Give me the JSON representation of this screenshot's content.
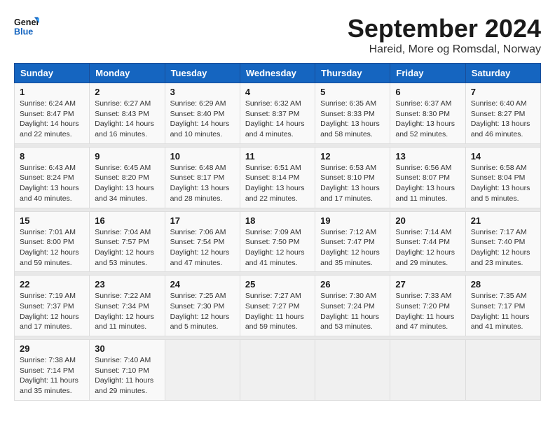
{
  "header": {
    "logo_line1": "General",
    "logo_line2": "Blue",
    "month": "September 2024",
    "location": "Hareid, More og Romsdal, Norway"
  },
  "days_of_week": [
    "Sunday",
    "Monday",
    "Tuesday",
    "Wednesday",
    "Thursday",
    "Friday",
    "Saturday"
  ],
  "weeks": [
    [
      {
        "day": "1",
        "rise": "6:24 AM",
        "set": "8:47 PM",
        "daylight": "14 hours and 22 minutes."
      },
      {
        "day": "2",
        "rise": "6:27 AM",
        "set": "8:43 PM",
        "daylight": "14 hours and 16 minutes."
      },
      {
        "day": "3",
        "rise": "6:29 AM",
        "set": "8:40 PM",
        "daylight": "14 hours and 10 minutes."
      },
      {
        "day": "4",
        "rise": "6:32 AM",
        "set": "8:37 PM",
        "daylight": "14 hours and 4 minutes."
      },
      {
        "day": "5",
        "rise": "6:35 AM",
        "set": "8:33 PM",
        "daylight": "13 hours and 58 minutes."
      },
      {
        "day": "6",
        "rise": "6:37 AM",
        "set": "8:30 PM",
        "daylight": "13 hours and 52 minutes."
      },
      {
        "day": "7",
        "rise": "6:40 AM",
        "set": "8:27 PM",
        "daylight": "13 hours and 46 minutes."
      }
    ],
    [
      {
        "day": "8",
        "rise": "6:43 AM",
        "set": "8:24 PM",
        "daylight": "13 hours and 40 minutes."
      },
      {
        "day": "9",
        "rise": "6:45 AM",
        "set": "8:20 PM",
        "daylight": "13 hours and 34 minutes."
      },
      {
        "day": "10",
        "rise": "6:48 AM",
        "set": "8:17 PM",
        "daylight": "13 hours and 28 minutes."
      },
      {
        "day": "11",
        "rise": "6:51 AM",
        "set": "8:14 PM",
        "daylight": "13 hours and 22 minutes."
      },
      {
        "day": "12",
        "rise": "6:53 AM",
        "set": "8:10 PM",
        "daylight": "13 hours and 17 minutes."
      },
      {
        "day": "13",
        "rise": "6:56 AM",
        "set": "8:07 PM",
        "daylight": "13 hours and 11 minutes."
      },
      {
        "day": "14",
        "rise": "6:58 AM",
        "set": "8:04 PM",
        "daylight": "13 hours and 5 minutes."
      }
    ],
    [
      {
        "day": "15",
        "rise": "7:01 AM",
        "set": "8:00 PM",
        "daylight": "12 hours and 59 minutes."
      },
      {
        "day": "16",
        "rise": "7:04 AM",
        "set": "7:57 PM",
        "daylight": "12 hours and 53 minutes."
      },
      {
        "day": "17",
        "rise": "7:06 AM",
        "set": "7:54 PM",
        "daylight": "12 hours and 47 minutes."
      },
      {
        "day": "18",
        "rise": "7:09 AM",
        "set": "7:50 PM",
        "daylight": "12 hours and 41 minutes."
      },
      {
        "day": "19",
        "rise": "7:12 AM",
        "set": "7:47 PM",
        "daylight": "12 hours and 35 minutes."
      },
      {
        "day": "20",
        "rise": "7:14 AM",
        "set": "7:44 PM",
        "daylight": "12 hours and 29 minutes."
      },
      {
        "day": "21",
        "rise": "7:17 AM",
        "set": "7:40 PM",
        "daylight": "12 hours and 23 minutes."
      }
    ],
    [
      {
        "day": "22",
        "rise": "7:19 AM",
        "set": "7:37 PM",
        "daylight": "12 hours and 17 minutes."
      },
      {
        "day": "23",
        "rise": "7:22 AM",
        "set": "7:34 PM",
        "daylight": "12 hours and 11 minutes."
      },
      {
        "day": "24",
        "rise": "7:25 AM",
        "set": "7:30 PM",
        "daylight": "12 hours and 5 minutes."
      },
      {
        "day": "25",
        "rise": "7:27 AM",
        "set": "7:27 PM",
        "daylight": "11 hours and 59 minutes."
      },
      {
        "day": "26",
        "rise": "7:30 AM",
        "set": "7:24 PM",
        "daylight": "11 hours and 53 minutes."
      },
      {
        "day": "27",
        "rise": "7:33 AM",
        "set": "7:20 PM",
        "daylight": "11 hours and 47 minutes."
      },
      {
        "day": "28",
        "rise": "7:35 AM",
        "set": "7:17 PM",
        "daylight": "11 hours and 41 minutes."
      }
    ],
    [
      {
        "day": "29",
        "rise": "7:38 AM",
        "set": "7:14 PM",
        "daylight": "11 hours and 35 minutes."
      },
      {
        "day": "30",
        "rise": "7:40 AM",
        "set": "7:10 PM",
        "daylight": "11 hours and 29 minutes."
      },
      null,
      null,
      null,
      null,
      null
    ]
  ],
  "labels": {
    "sunrise": "Sunrise:",
    "sunset": "Sunset:",
    "daylight": "Daylight:"
  }
}
